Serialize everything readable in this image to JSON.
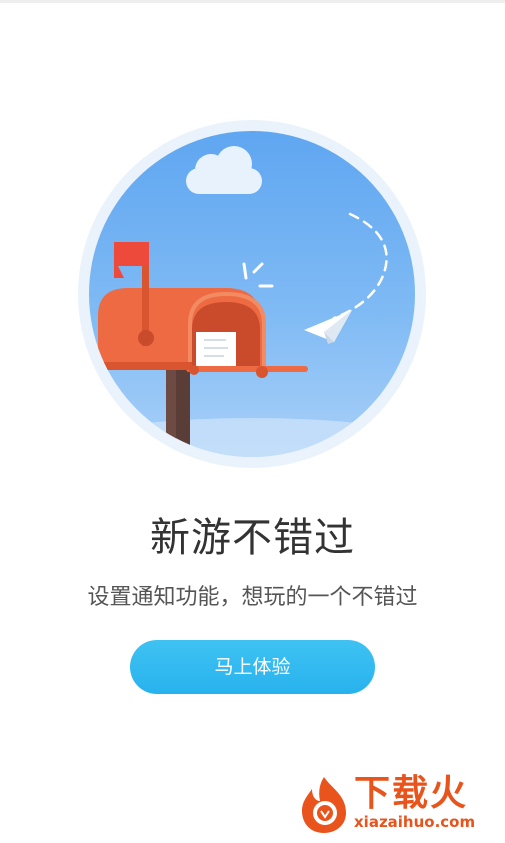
{
  "hero": {
    "title": "新游不错过",
    "subtitle": "设置通知功能，想玩的一个不错过"
  },
  "actions": {
    "primary_label": "马上体验"
  },
  "watermark": {
    "brand": "下载火",
    "url": "xiazaihuo.com"
  },
  "icons": {
    "illustration": "mailbox-illustration",
    "logo": "flame-logo-icon"
  },
  "colors": {
    "accent": "#2ab4ee",
    "sky": "#6fb0f2",
    "mailbox": "#f06c45",
    "brand": "#e8541c"
  }
}
